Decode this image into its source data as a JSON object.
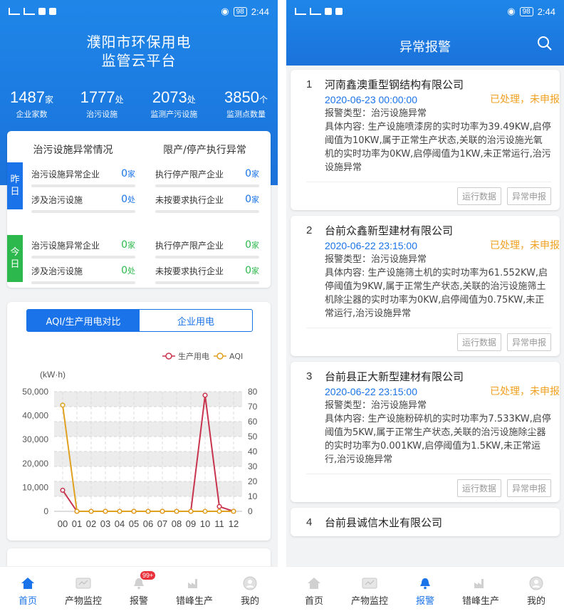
{
  "status_bar": {
    "left": "HD 4G 4G",
    "time": "2:44",
    "battery": "98"
  },
  "home": {
    "title_line1": "濮阳市环保用电",
    "title_line2": "监管云平台",
    "stats": [
      {
        "value": "1487",
        "unit": "家",
        "label": "企业家数"
      },
      {
        "value": "1777",
        "unit": "处",
        "label": "治污设施"
      },
      {
        "value": "2073",
        "unit": "处",
        "label": "监测产污设施"
      },
      {
        "value": "3850",
        "unit": "个",
        "label": "监测点数量"
      }
    ],
    "abnormal": {
      "col1_title": "治污设施异常情况",
      "col2_title": "限产/停产执行异常",
      "yesterday_tag": "昨日",
      "today_tag": "今日",
      "yesterday": [
        {
          "label": "治污设施异常企业",
          "value": "0",
          "unit": "家"
        },
        {
          "label": "执行停产限产企业",
          "value": "0",
          "unit": "家"
        },
        {
          "label": "涉及治污设施",
          "value": "0",
          "unit": "处"
        },
        {
          "label": "未按要求执行企业",
          "value": "0",
          "unit": "家"
        }
      ],
      "today": [
        {
          "label": "治污设施异常企业",
          "value": "0",
          "unit": "家"
        },
        {
          "label": "执行停产限产企业",
          "value": "0",
          "unit": "家"
        },
        {
          "label": "涉及治污设施",
          "value": "0",
          "unit": "处"
        },
        {
          "label": "未按要求执行企业",
          "value": "0",
          "unit": "家"
        }
      ]
    },
    "chart_tabs": {
      "active": "AQI/生产用电对比",
      "inactive": "企业用电"
    }
  },
  "chart_data": {
    "type": "line",
    "categories": [
      "00",
      "01",
      "02",
      "03",
      "04",
      "05",
      "06",
      "07",
      "08",
      "09",
      "10",
      "11",
      "12"
    ],
    "ylabel": "(kW·h)",
    "ylim": [
      0,
      50000
    ],
    "ylim_right": [
      0,
      80
    ],
    "left_ticks": [
      "0",
      "10,000",
      "20,000",
      "30,000",
      "40,000",
      "50,000"
    ],
    "right_ticks": [
      "0",
      "10",
      "20",
      "30",
      "40",
      "50",
      "60",
      "70",
      "80"
    ],
    "legend_placement": "top-right",
    "series": [
      {
        "name": "生产用电",
        "axis": "left",
        "color": "#c8344e",
        "values": [
          8800,
          0,
          0,
          0,
          0,
          0,
          0,
          0,
          0,
          0,
          48500,
          2000,
          0
        ]
      },
      {
        "name": "AQI",
        "axis": "right",
        "color": "#e0a020",
        "values": [
          71,
          0,
          0,
          0,
          0,
          0,
          0,
          0,
          0,
          0,
          0,
          0,
          0
        ]
      }
    ]
  },
  "tabbar": {
    "items": [
      "首页",
      "产物监控",
      "报警",
      "错峰生产",
      "我的"
    ],
    "badge": "99+"
  },
  "alarm_page": {
    "title": "异常报警",
    "type_prefix": "报警类型：",
    "content_prefix": "具体内容: ",
    "btn_run_data": "运行数据",
    "btn_report": "异常申报",
    "items": [
      {
        "index": "1",
        "company": "河南鑫澳重型钢结构有限公司",
        "time": "2020-06-23 00:00:00",
        "status": "已处理，未申报",
        "type": "治污设施异常",
        "content": "生产设施喷漆房的实时功率为39.49KW,启停阈值为10KW,属于正常生产状态,关联的治污设施光氧机的实时功率为0KW,启停阈值为1KW,未正常运行,治污设施异常"
      },
      {
        "index": "2",
        "company": "台前众鑫新型建材有限公司",
        "time": "2020-06-22 23:15:00",
        "status": "已处理，未申报",
        "type": "治污设施异常",
        "content": "生产设施筛土机的实时功率为61.552KW,启停阈值为9KW,属于正常生产状态,关联的治污设施筛土机除尘器的实时功率为0KW,启停阈值为0.75KW,未正常运行,治污设施异常"
      },
      {
        "index": "3",
        "company": "台前县正大新型建材有限公司",
        "time": "2020-06-22 23:15:00",
        "status": "已处理，未申报",
        "type": "治污设施异常",
        "content": "生产设施粉碎机的实时功率为7.533KW,启停阈值为5KW,属于正常生产状态,关联的治污设施除尘器的实时功率为0.001KW,启停阈值为1.5KW,未正常运行,治污设施异常"
      },
      {
        "index": "4",
        "company": "台前县诚信木业有限公司"
      }
    ]
  },
  "colors": {
    "primary": "#1a73e8",
    "yesterday_tag": "#1a73e8",
    "today_tag": "#2db84d",
    "status": "#f0a020"
  }
}
